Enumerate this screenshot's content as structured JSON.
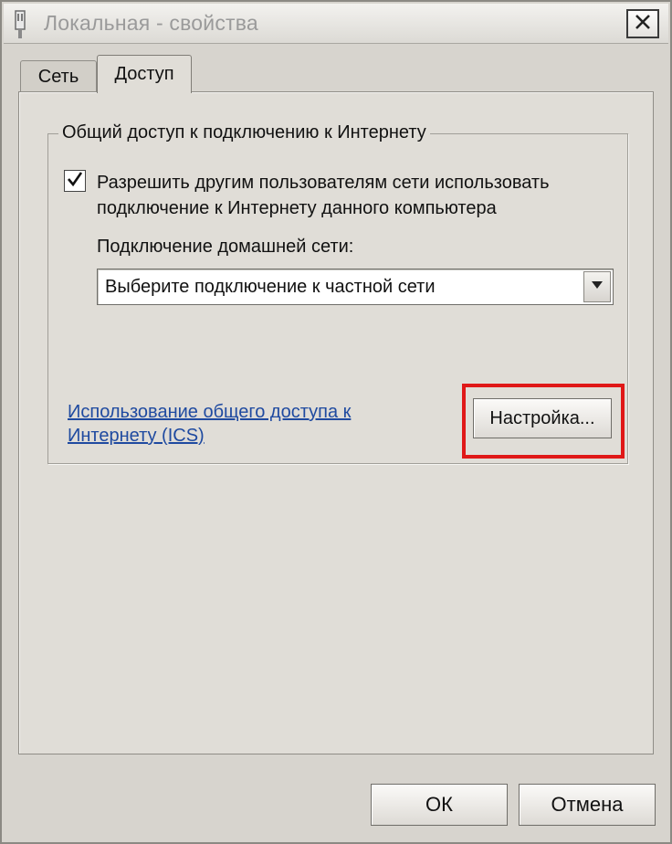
{
  "window": {
    "title": "Локальная - свойства",
    "icon": "network-adapter-icon"
  },
  "tabs": [
    {
      "label": "Сеть",
      "active": false
    },
    {
      "label": "Доступ",
      "active": true
    }
  ],
  "sharing_group": {
    "title": "Общий доступ к подключению к Интернету",
    "allow_checkbox": {
      "checked": true,
      "label": "Разрешить другим пользователям сети использовать подключение к Интернету данного компьютера"
    },
    "home_connection_label": "Подключение домашней сети:",
    "home_connection_select": {
      "value": "Выберите подключение к частной сети"
    },
    "ics_link": "Использование общего доступа к Интернету (ICS)",
    "settings_button": "Настройка..."
  },
  "buttons": {
    "ok": "ОК",
    "cancel": "Отмена"
  },
  "colors": {
    "highlight": "#e01818",
    "link": "#1f4aa0"
  }
}
